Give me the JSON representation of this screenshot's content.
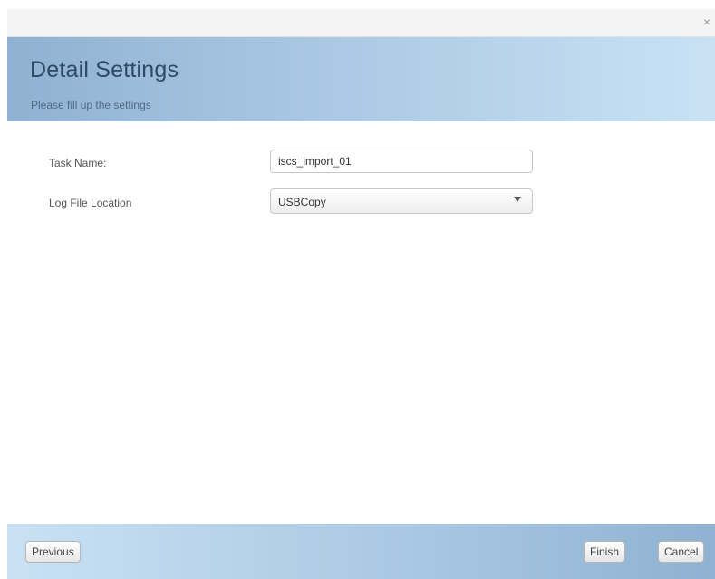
{
  "titlebar": {
    "close_glyph": "×",
    "close_icon": "close-icon"
  },
  "header": {
    "title": "Detail Settings",
    "subtitle": "Please fill up the settings"
  },
  "form": {
    "task_name": {
      "label": "Task Name:",
      "value": "iscs_import_01"
    },
    "log_file_location": {
      "label": "Log File Location",
      "selected": "USBCopy",
      "arrow_icon": "chevron-down-icon"
    }
  },
  "footer": {
    "previous_label": "Previous",
    "finish_label": "Finish",
    "cancel_label": "Cancel"
  },
  "colors": {
    "header_gradient_start": "#8fb2d2",
    "header_gradient_end": "#c9e1f3",
    "title_text": "#2e4a66"
  }
}
